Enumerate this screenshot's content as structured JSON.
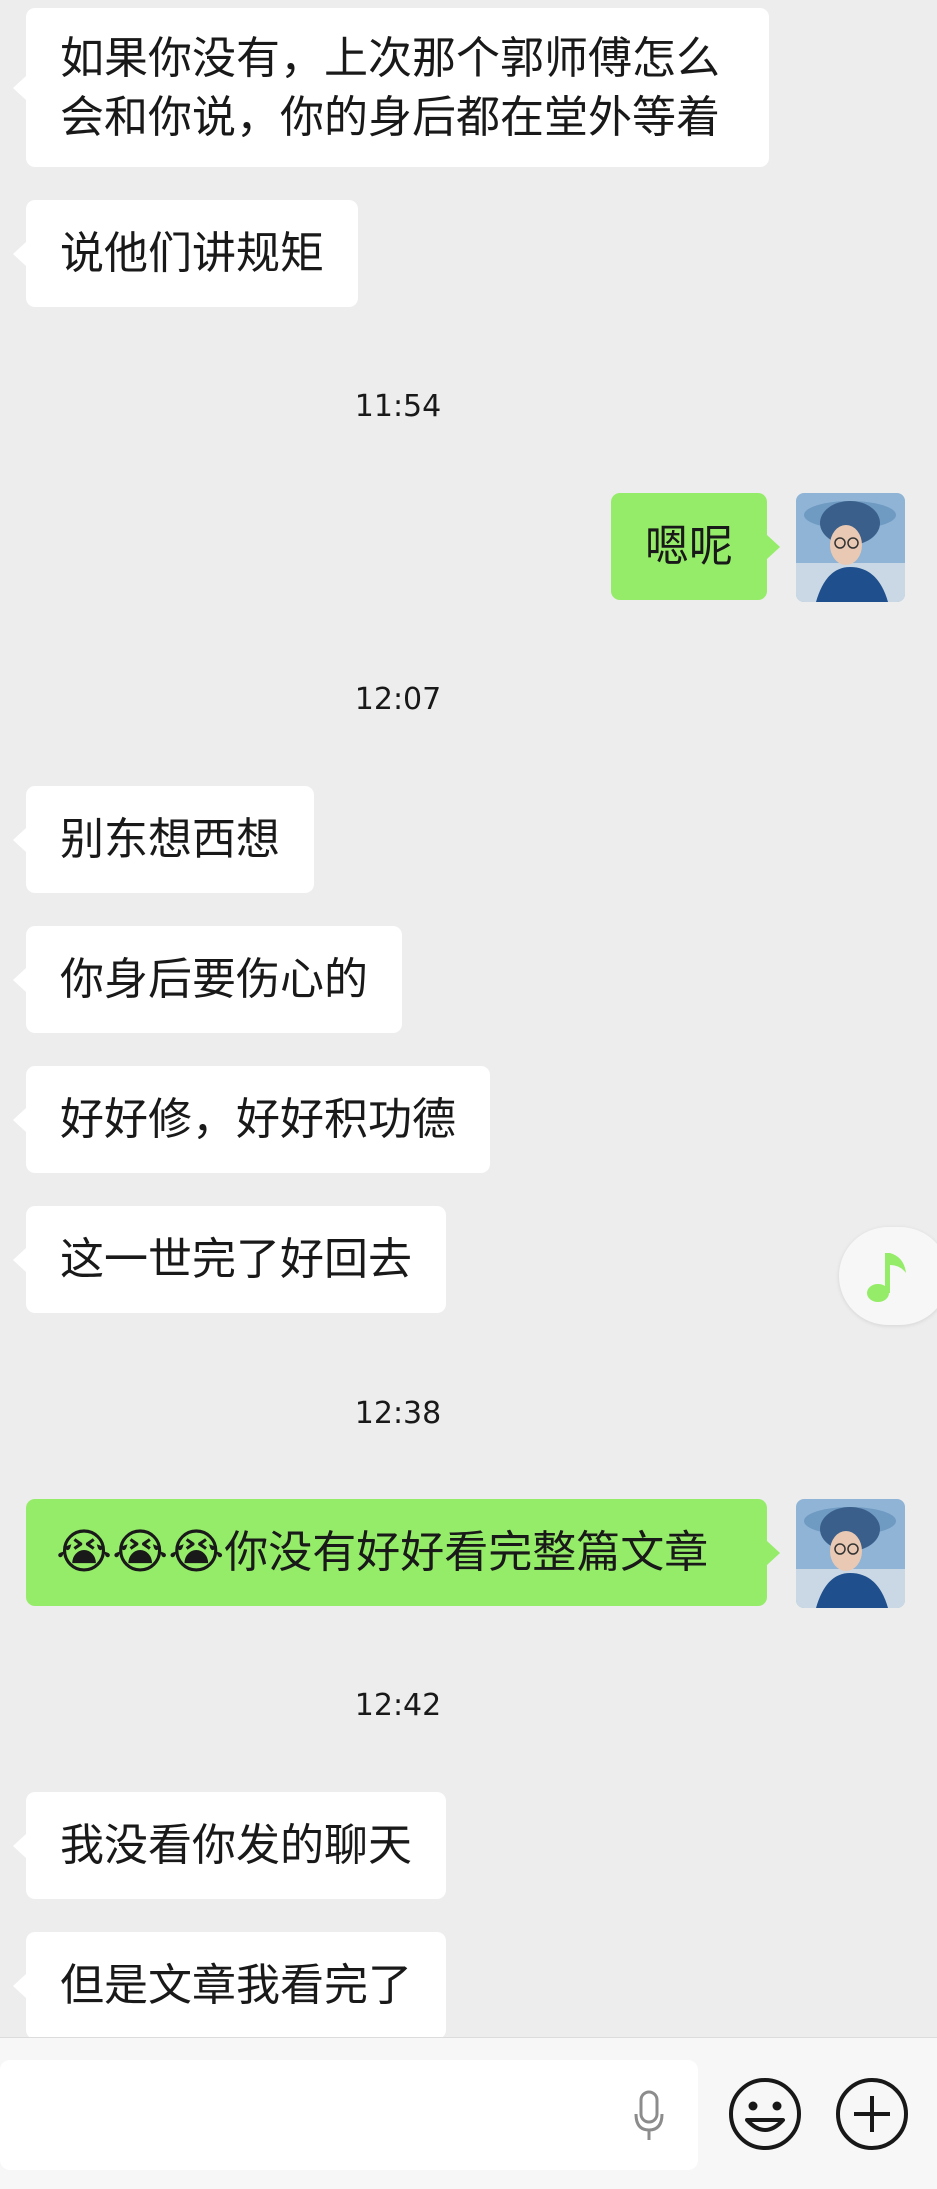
{
  "messages": [
    {
      "side": "left",
      "text": "如果你没有，上次那个郭师傅怎么会和你说，你的身后都在堂外等着"
    },
    {
      "side": "left",
      "text": "说他们讲规矩"
    },
    {
      "time": "11:54"
    },
    {
      "side": "right",
      "text": "嗯呢"
    },
    {
      "time": "12:07"
    },
    {
      "side": "left",
      "text": "别东想西想"
    },
    {
      "side": "left",
      "text": "你身后要伤心的"
    },
    {
      "side": "left",
      "text": "好好修，好好积功德"
    },
    {
      "side": "left",
      "text": "这一世完了好回去"
    },
    {
      "time": "12:38"
    },
    {
      "side": "right",
      "emojis": [
        "😭",
        "😭",
        "😭"
      ],
      "text": "你没有好好看完整篇文章"
    },
    {
      "time": "12:42"
    },
    {
      "side": "left",
      "text": "我没看你发的聊天"
    },
    {
      "side": "left",
      "text": "但是文章我看完了"
    }
  ],
  "icons": {
    "float_button": "music-note-icon",
    "voice": "microphone-icon",
    "emoji": "smiley-icon",
    "more": "plus-circle-icon"
  },
  "colors": {
    "background": "#ededed",
    "incoming_bubble": "#ffffff",
    "outgoing_bubble": "#95ec69",
    "accent": "#95ec69"
  }
}
